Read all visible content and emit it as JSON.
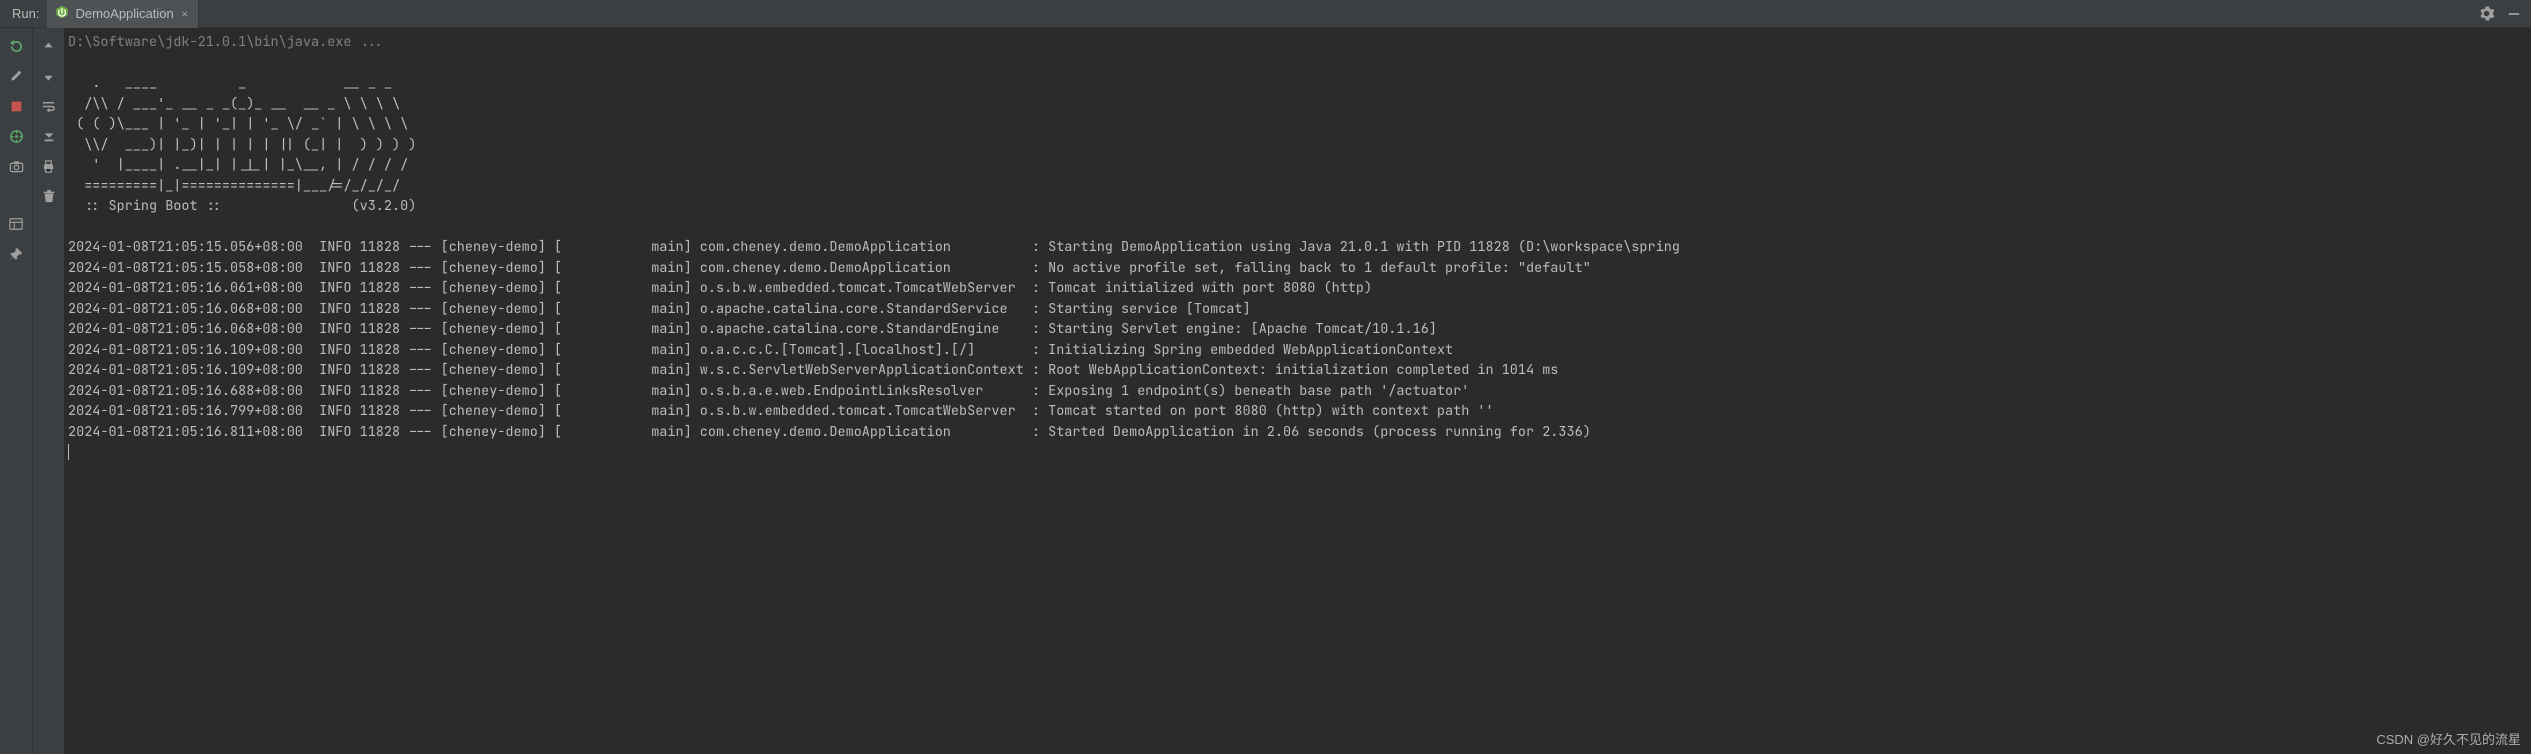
{
  "header": {
    "run_label": "Run:",
    "tab_label": "DemoApplication",
    "gear_title": "Settings",
    "minimize_title": "Hide"
  },
  "gutter1": {
    "rerun": "Rerun",
    "edit": "Modify Run Configuration",
    "stop": "Stop",
    "dump": "Dump Threads",
    "camera": "Attach",
    "layout": "Layout",
    "pin": "Pin Tab"
  },
  "gutter2": {
    "up": "Up the Stack Trace",
    "down": "Down the Stack Trace",
    "wrap": "Soft-Wrap",
    "scroll": "Scroll to End",
    "print": "Print",
    "trash": "Clear All"
  },
  "console": {
    "cmd": "D:\\Software\\jdk-21.0.1\\bin\\java.exe ...",
    "ascii": [
      "   .   ____          _            __ _ _",
      "  /\\\\ / ___'_ __ _ _(_)_ __  __ _ \\ \\ \\ \\",
      " ( ( )\\___ | '_ | '_| | '_ \\/ _` | \\ \\ \\ \\",
      "  \\\\/  ___)| |_)| | | | | || (_| |  ) ) ) )",
      "   '  |____| .__|_| |_|_| |_\\__, | / / / /",
      "  =========|_|==============|___/=/_/_/_/",
      "  :: Spring Boot ::                (v3.2.0)"
    ],
    "logs": [
      {
        "ts": "2024-01-08T21:05:15.056+08:00",
        "lvl": "INFO",
        "pid": "11828",
        "tags": "--- [cheney-demo] [           main]",
        "logger": "com.cheney.demo.DemoApplication         ",
        "msg": "Starting DemoApplication using Java 21.0.1 with PID 11828 (D:\\workspace\\spring"
      },
      {
        "ts": "2024-01-08T21:05:15.058+08:00",
        "lvl": "INFO",
        "pid": "11828",
        "tags": "--- [cheney-demo] [           main]",
        "logger": "com.cheney.demo.DemoApplication         ",
        "msg": "No active profile set, falling back to 1 default profile: \"default\""
      },
      {
        "ts": "2024-01-08T21:05:16.061+08:00",
        "lvl": "INFO",
        "pid": "11828",
        "tags": "--- [cheney-demo] [           main]",
        "logger": "o.s.b.w.embedded.tomcat.TomcatWebServer ",
        "msg": "Tomcat initialized with port 8080 (http)"
      },
      {
        "ts": "2024-01-08T21:05:16.068+08:00",
        "lvl": "INFO",
        "pid": "11828",
        "tags": "--- [cheney-demo] [           main]",
        "logger": "o.apache.catalina.core.StandardService  ",
        "msg": "Starting service [Tomcat]"
      },
      {
        "ts": "2024-01-08T21:05:16.068+08:00",
        "lvl": "INFO",
        "pid": "11828",
        "tags": "--- [cheney-demo] [           main]",
        "logger": "o.apache.catalina.core.StandardEngine   ",
        "msg": "Starting Servlet engine: [Apache Tomcat/10.1.16]"
      },
      {
        "ts": "2024-01-08T21:05:16.109+08:00",
        "lvl": "INFO",
        "pid": "11828",
        "tags": "--- [cheney-demo] [           main]",
        "logger": "o.a.c.c.C.[Tomcat].[localhost].[/]      ",
        "msg": "Initializing Spring embedded WebApplicationContext"
      },
      {
        "ts": "2024-01-08T21:05:16.109+08:00",
        "lvl": "INFO",
        "pid": "11828",
        "tags": "--- [cheney-demo] [           main]",
        "logger": "w.s.c.ServletWebServerApplicationContext",
        "msg": "Root WebApplicationContext: initialization completed in 1014 ms"
      },
      {
        "ts": "2024-01-08T21:05:16.688+08:00",
        "lvl": "INFO",
        "pid": "11828",
        "tags": "--- [cheney-demo] [           main]",
        "logger": "o.s.b.a.e.web.EndpointLinksResolver     ",
        "msg": "Exposing 1 endpoint(s) beneath base path '/actuator'"
      },
      {
        "ts": "2024-01-08T21:05:16.799+08:00",
        "lvl": "INFO",
        "pid": "11828",
        "tags": "--- [cheney-demo] [           main]",
        "logger": "o.s.b.w.embedded.tomcat.TomcatWebServer ",
        "msg": "Tomcat started on port 8080 (http) with context path ''"
      },
      {
        "ts": "2024-01-08T21:05:16.811+08:00",
        "lvl": "INFO",
        "pid": "11828",
        "tags": "--- [cheney-demo] [           main]",
        "logger": "com.cheney.demo.DemoApplication         ",
        "msg": "Started DemoApplication in 2.06 seconds (process running for 2.336)"
      }
    ]
  },
  "watermark": "CSDN @好久不见的流星"
}
